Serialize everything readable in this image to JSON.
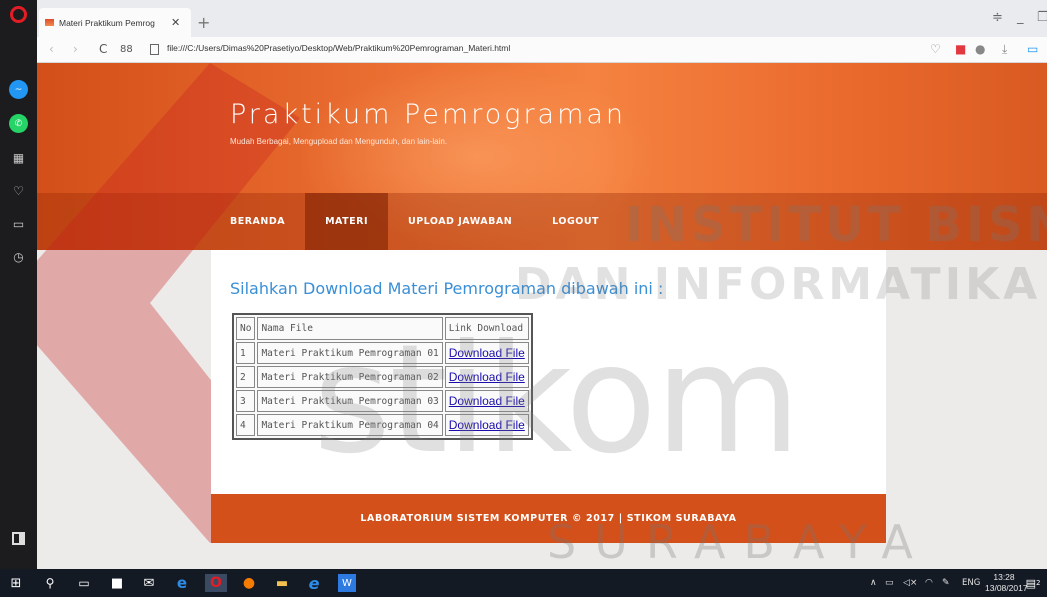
{
  "browser": {
    "tab_title": "Materi Praktikum Pemrog",
    "url": "file:///C:/Users/Dimas%20Prasetiyo/Desktop/Web/Praktikum%20Pemrograman_Materi.html",
    "speed_dial_label": "88"
  },
  "site": {
    "title": "Praktikum Pemrograman",
    "subtitle": "Mudah Berbagai, Mengupload dan Mengunduh, dan lain-lain.",
    "menu": [
      "BERANDA",
      "MATERI",
      "UPLOAD JAWABAN",
      "LOGOUT"
    ],
    "active_menu": "MATERI"
  },
  "content": {
    "heading": "Silahkan Download Materi Pemrograman dibawah ini :",
    "table": {
      "headers": [
        "No",
        "Nama File",
        "Link Download"
      ],
      "rows": [
        [
          "1",
          "Materi Praktikum Pemrograman 01",
          "Download File"
        ],
        [
          "2",
          "Materi Praktikum Pemrograman 02",
          "Download File"
        ],
        [
          "3",
          "Materi Praktikum Pemrograman 03",
          "Download File"
        ],
        [
          "4",
          "Materi Praktikum Pemrograman 04",
          "Download File"
        ]
      ]
    }
  },
  "footer": {
    "text": "LABORATORIUM SISTEM KOMPUTER © 2017 | STIKOM SURABAYA"
  },
  "watermark": {
    "line1": "INSTITUT BISNIS",
    "line2": "DAN INFORMATIKA",
    "brand": "stikom",
    "city": "SURABAYA"
  },
  "taskbar": {
    "language": "ENG",
    "time": "13:28",
    "date": "13/08/2017",
    "notifications": "2"
  },
  "colors": {
    "header_orange": "#e86a2e",
    "footer_orange": "#d3501a",
    "heading_blue": "#3a8fd6",
    "link_blue": "#1a0dab"
  }
}
